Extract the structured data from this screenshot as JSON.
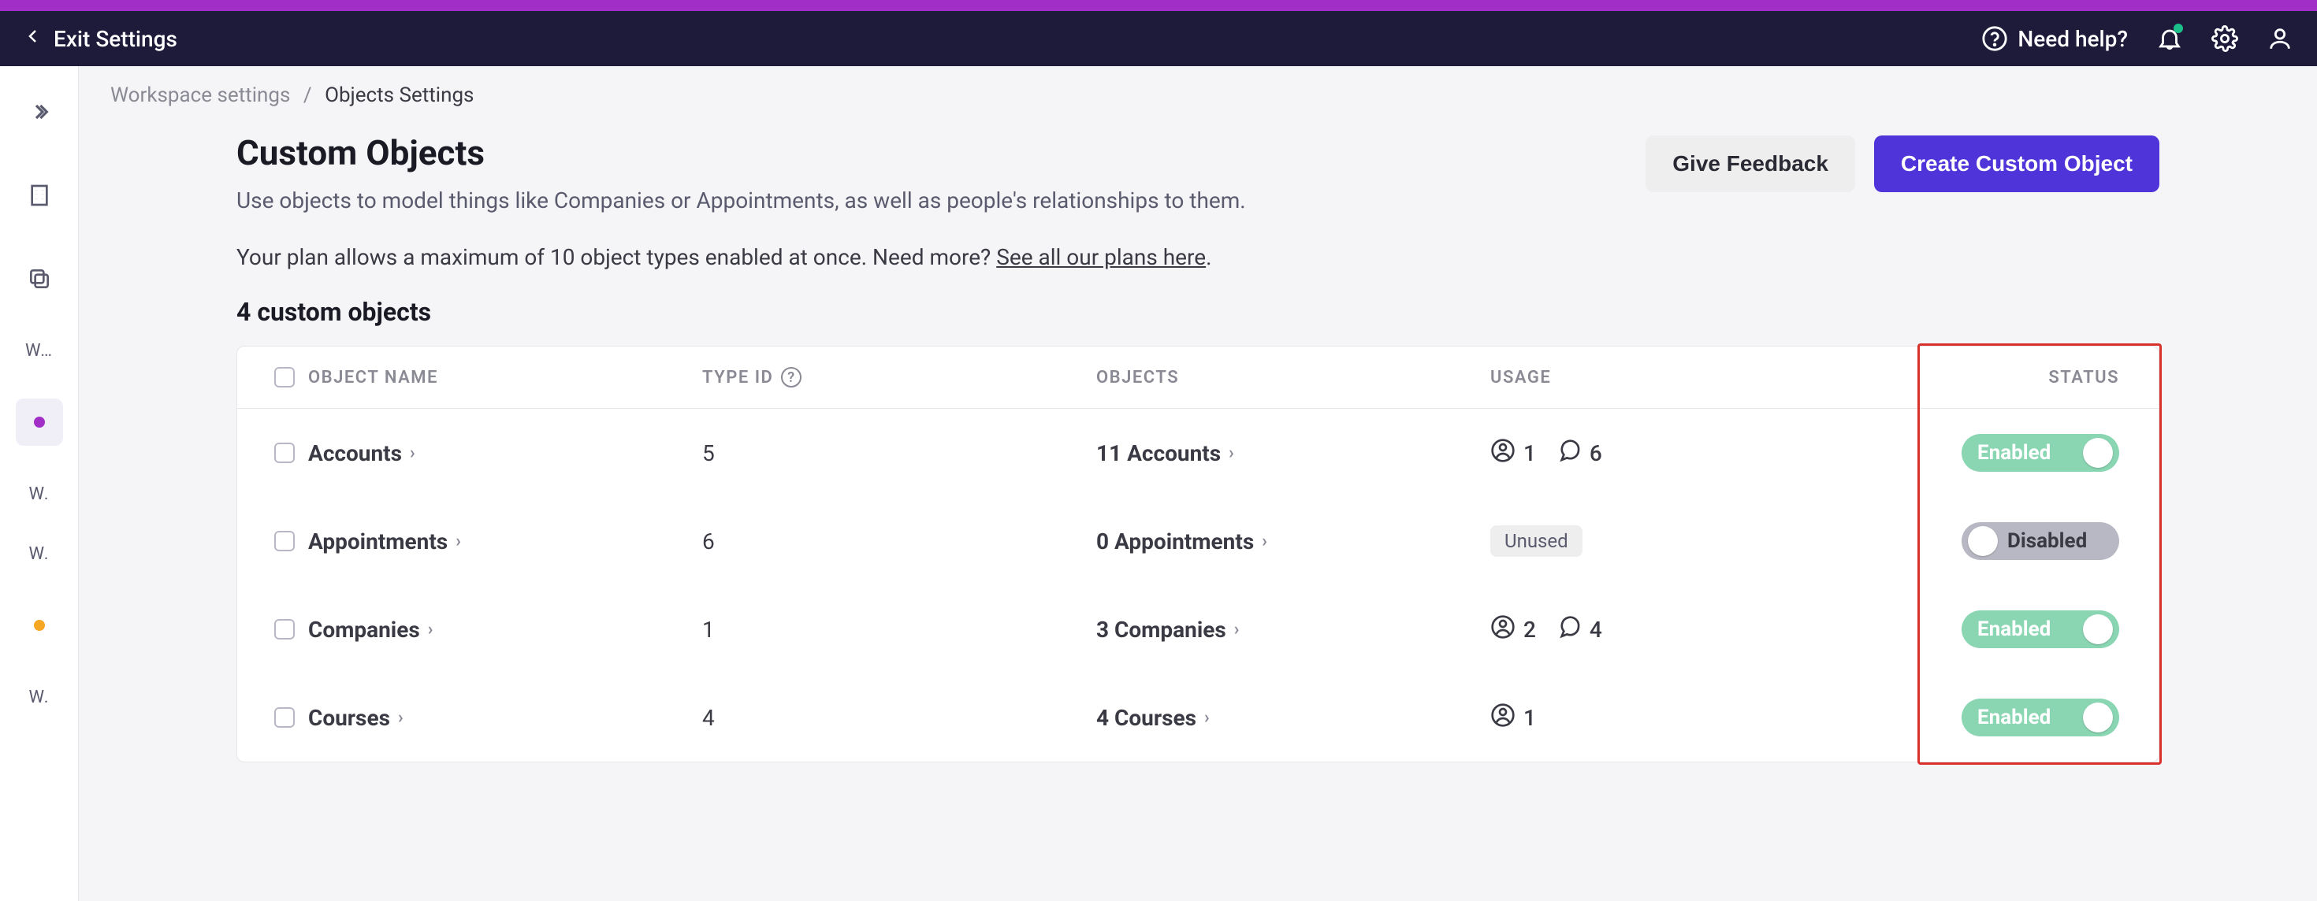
{
  "header": {
    "exit_label": "Exit Settings",
    "need_help_label": "Need help?"
  },
  "sidebar": {
    "items": [
      {
        "kind": "expand"
      },
      {
        "kind": "icon",
        "name": "building-icon"
      },
      {
        "kind": "icon",
        "name": "copy-icon"
      },
      {
        "kind": "label",
        "text": "W…"
      },
      {
        "kind": "dot-purple",
        "active": true
      },
      {
        "kind": "label",
        "text": "W."
      },
      {
        "kind": "label",
        "text": "W."
      },
      {
        "kind": "dot-orange"
      },
      {
        "kind": "label",
        "text": "W."
      }
    ]
  },
  "breadcrumb": {
    "parent": "Workspace settings",
    "current": "Objects Settings"
  },
  "page": {
    "title": "Custom Objects",
    "subtitle": "Use objects to model things like Companies or Appointments, as well as people's relationships to them.",
    "plan_line_prefix": "Your plan allows a maximum of 10 object types enabled at once. Need more? ",
    "plan_link": "See all our plans here",
    "plan_line_suffix": ".",
    "count_heading": "4 custom objects",
    "feedback_label": "Give Feedback",
    "create_label": "Create Custom Object"
  },
  "table": {
    "headers": {
      "name": "OBJECT NAME",
      "type": "TYPE ID",
      "objects": "OBJECTS",
      "usage": "USAGE",
      "status": "STATUS"
    },
    "status_labels": {
      "on": "Enabled",
      "off": "Disabled"
    },
    "unused_label": "Unused",
    "rows": [
      {
        "name": "Accounts",
        "type_id": "5",
        "objects_label": "11 Accounts",
        "usage": {
          "people": "1",
          "conversations": "6"
        },
        "enabled": true
      },
      {
        "name": "Appointments",
        "type_id": "6",
        "objects_label": "0 Appointments",
        "usage": {
          "unused": true
        },
        "enabled": false
      },
      {
        "name": "Companies",
        "type_id": "1",
        "objects_label": "3 Companies",
        "usage": {
          "people": "2",
          "conversations": "4"
        },
        "enabled": true
      },
      {
        "name": "Courses",
        "type_id": "4",
        "objects_label": "4 Courses",
        "usage": {
          "people": "1"
        },
        "enabled": true
      }
    ]
  },
  "colors": {
    "stripe": "#a12fc7",
    "header_bg": "#1e1a3a",
    "primary": "#4f35d9",
    "enabled": "#8ad6b3",
    "disabled": "#b8b8c4",
    "highlight": "#d9302c"
  }
}
